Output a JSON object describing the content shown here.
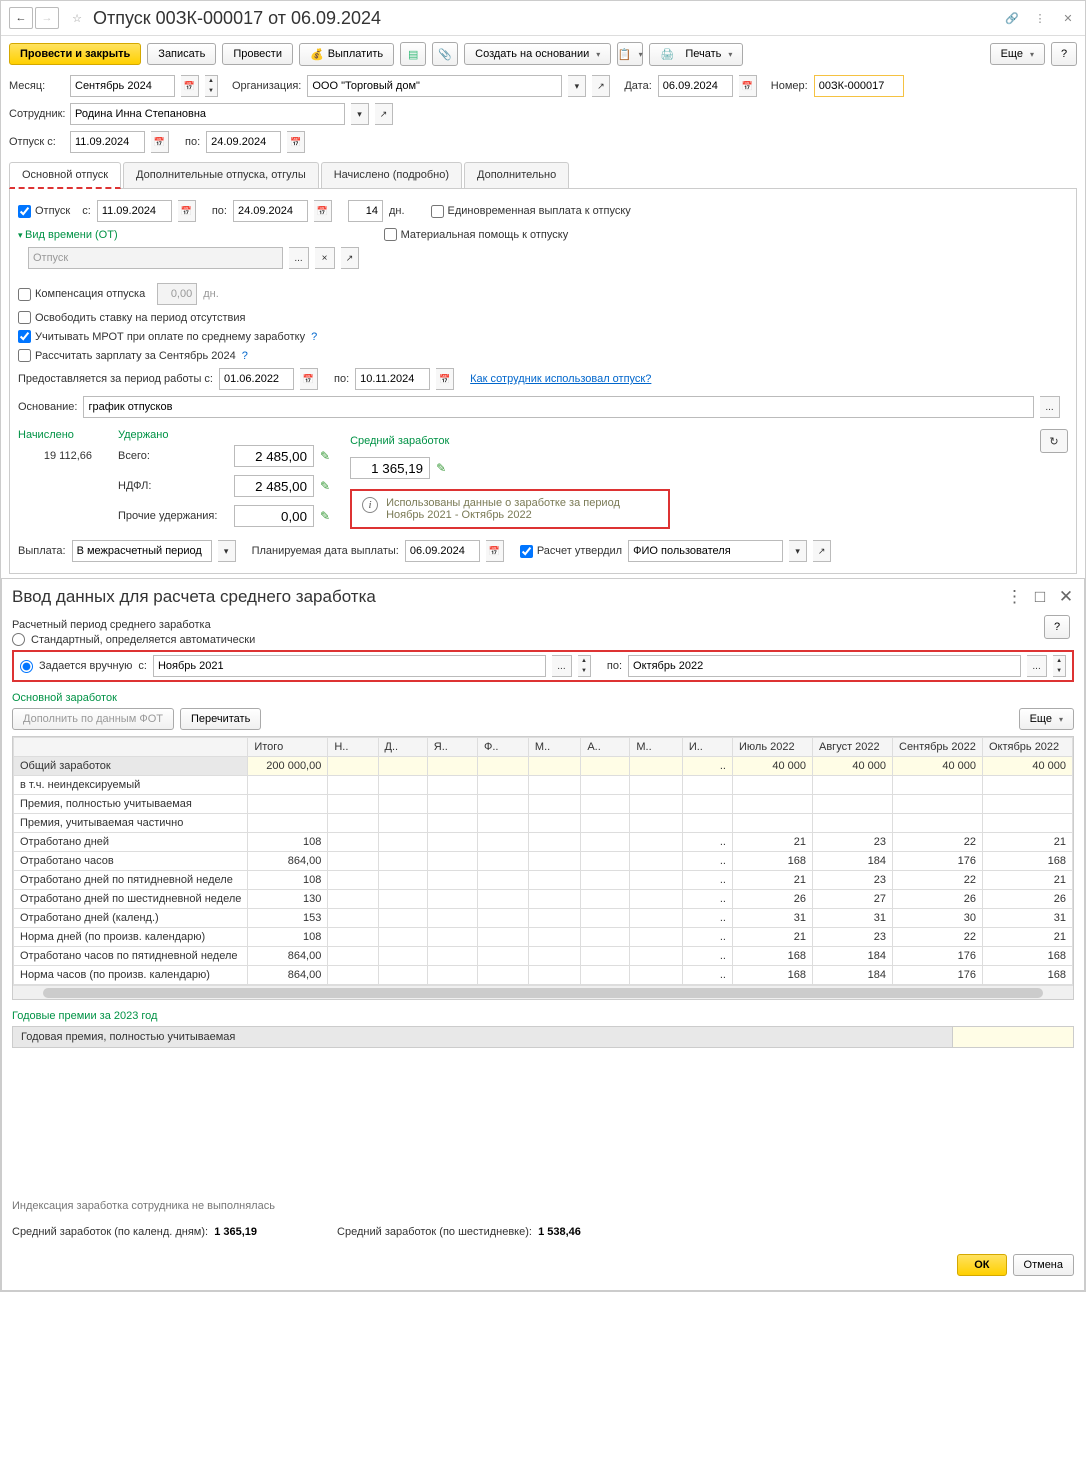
{
  "title": "Отпуск 00ЗК-000017 от 06.09.2024",
  "toolbar": {
    "post_close": "Провести и закрыть",
    "save": "Записать",
    "post": "Провести",
    "pay": "Выплатить",
    "create_based": "Создать на основании",
    "print": "Печать",
    "more": "Еще"
  },
  "header": {
    "month_lbl": "Месяц:",
    "month": "Сентябрь 2024",
    "org_lbl": "Организация:",
    "org": "ООО \"Торговый дом\"",
    "date_lbl": "Дата:",
    "date": "06.09.2024",
    "num_lbl": "Номер:",
    "num": "00ЗК-000017",
    "emp_lbl": "Сотрудник:",
    "emp": "Родина Инна Степановна",
    "from_lbl": "Отпуск с:",
    "from": "11.09.2024",
    "to_lbl": "по:",
    "to": "24.09.2024"
  },
  "tabs": {
    "main": "Основной отпуск",
    "extra": "Дополнительные отпуска, отгулы",
    "accrued": "Начислено (подробно)",
    "addl": "Дополнительно"
  },
  "main_tab": {
    "vac_chk": "Отпуск",
    "from_lbl": "с:",
    "from": "11.09.2024",
    "to_lbl": "по:",
    "to": "24.09.2024",
    "days": "14",
    "days_lbl": "дн.",
    "onetime_chk": "Единовременная выплата к отпуску",
    "mathelp_chk": "Материальная помощь к отпуску",
    "time_type": "Вид времени (ОТ)",
    "time_type_val": "Отпуск",
    "comp_chk": "Компенсация отпуска",
    "comp_days": "0,00",
    "comp_days_lbl": "дн.",
    "release_chk": "Освободить ставку на период отсутствия",
    "mrot_chk": "Учитывать МРОТ при оплате по среднему заработку",
    "recalc_chk": "Рассчитать зарплату за Сентябрь 2024",
    "period_lbl": "Предоставляется за период работы с:",
    "period_from": "01.06.2022",
    "period_to_lbl": "по:",
    "period_to": "10.11.2024",
    "used_link": "Как сотрудник использовал отпуск?",
    "basis_lbl": "Основание:",
    "basis": "график отпусков"
  },
  "calc": {
    "accrued_lbl": "Начислено",
    "accrued": "19 112,66",
    "withheld_lbl": "Удержано",
    "total_lbl": "Всего:",
    "total": "2 485,00",
    "ndfl_lbl": "НДФЛ:",
    "ndfl": "2 485,00",
    "other_lbl": "Прочие удержания:",
    "other": "0,00",
    "avg_lbl": "Средний заработок",
    "avg": "1 365,19",
    "info_text": "Использованы данные о заработке за период Ноябрь 2021 - Октябрь 2022"
  },
  "payment": {
    "pay_lbl": "Выплата:",
    "pay_val": "В межрасчетный период",
    "plan_date_lbl": "Планируемая дата выплаты:",
    "plan_date": "06.09.2024",
    "approved_lbl": "Расчет утвердил",
    "approved_by": "ФИО пользователя"
  },
  "subwin": {
    "title": "Ввод данных для расчета среднего заработка",
    "period_lbl": "Расчетный период среднего заработка",
    "std_radio": "Стандартный, определяется автоматически",
    "manual_radio": "Задается вручную",
    "from_lbl": "с:",
    "from": "Ноябрь 2021",
    "to_lbl": "по:",
    "to": "Октябрь 2022",
    "main_earn_lbl": "Основной заработок",
    "fill_fot": "Дополнить по данным ФОТ",
    "reread": "Перечитать",
    "more": "Еще",
    "cols": {
      "total": "Итого",
      "n": "Н..",
      "d": "Д..",
      "ya": "Я..",
      "f": "Ф..",
      "m1": "М..",
      "a1": "А..",
      "m2": "М..",
      "i": "И..",
      "jul": "Июль 2022",
      "aug": "Август 2022",
      "sep": "Сентябрь 2022",
      "oct": "Октябрь 2022"
    },
    "rows": [
      {
        "label": "Общий заработок",
        "total": "200 000,00",
        "vals": [
          "..",
          "40 000",
          "40 000",
          "40 000",
          "40 000"
        ],
        "hl": true,
        "grey": true
      },
      {
        "label": "   в т.ч. неиндексируемый",
        "total": "",
        "vals": [
          "",
          "",
          "",
          "",
          ""
        ]
      },
      {
        "label": "Премия, полностью учитываемая",
        "total": "",
        "vals": [
          "",
          "",
          "",
          "",
          ""
        ]
      },
      {
        "label": "Премия, учитываемая частично",
        "total": "",
        "vals": [
          "",
          "",
          "",
          "",
          ""
        ]
      },
      {
        "label": "Отработано дней",
        "total": "108",
        "vals": [
          "..",
          "21",
          "23",
          "22",
          "21"
        ]
      },
      {
        "label": "Отработано часов",
        "total": "864,00",
        "vals": [
          "..",
          "168",
          "184",
          "176",
          "168"
        ]
      },
      {
        "label": "Отработано дней по пятидневной неделе",
        "total": "108",
        "vals": [
          "..",
          "21",
          "23",
          "22",
          "21"
        ]
      },
      {
        "label": "Отработано дней по шестидневной неделе",
        "total": "130",
        "vals": [
          "..",
          "26",
          "27",
          "26",
          "26"
        ]
      },
      {
        "label": "Отработано дней (календ.)",
        "total": "153",
        "vals": [
          "..",
          "31",
          "31",
          "30",
          "31"
        ]
      },
      {
        "label": "Норма дней (по произв. календарю)",
        "total": "108",
        "vals": [
          "..",
          "21",
          "23",
          "22",
          "21"
        ]
      },
      {
        "label": "Отработано часов по пятидневной неделе",
        "total": "864,00",
        "vals": [
          "..",
          "168",
          "184",
          "176",
          "168"
        ]
      },
      {
        "label": "Норма часов (по произв. календарю)",
        "total": "864,00",
        "vals": [
          "..",
          "168",
          "184",
          "176",
          "168"
        ]
      }
    ],
    "annual_lbl": "Годовые премии за 2023 год",
    "annual_row": "Годовая премия, полностью учитываемая",
    "index_info": "Индексация заработка сотрудника не выполнялась",
    "avg_cal_lbl": "Средний заработок (по календ. дням):",
    "avg_cal": "1 365,19",
    "avg_six_lbl": "Средний заработок (по шестидневке):",
    "avg_six": "1 538,46",
    "ok": "ОК",
    "cancel": "Отмена"
  }
}
